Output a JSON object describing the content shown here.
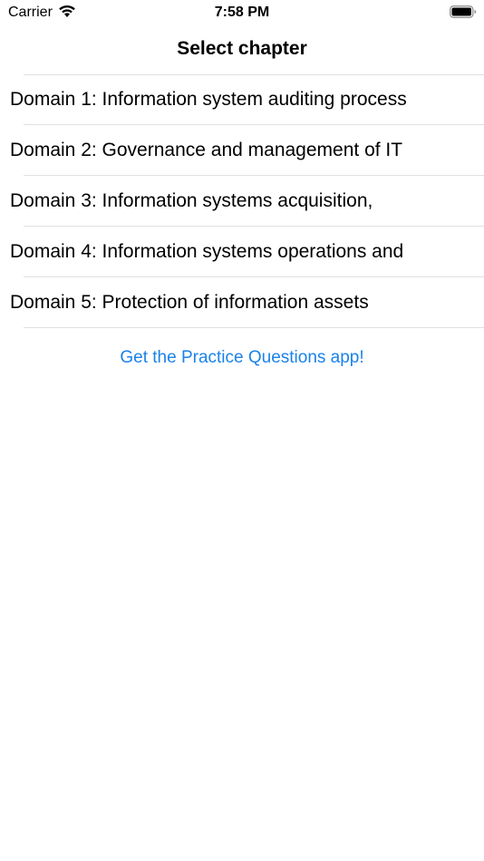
{
  "status_bar": {
    "carrier": "Carrier",
    "time": "7:58 PM",
    "icons": [
      "wifi-icon",
      "battery-icon"
    ]
  },
  "nav": {
    "title": "Select chapter"
  },
  "chapters": [
    {
      "label": "Domain 1: Information system auditing process"
    },
    {
      "label": "Domain 2: Governance and management of IT"
    },
    {
      "label": "Domain 3: Information systems acquisition,"
    },
    {
      "label": "Domain 4: Information systems operations and"
    },
    {
      "label": "Domain 5: Protection of information assets"
    }
  ],
  "promo": {
    "link_text": "Get the Practice Questions app!"
  },
  "colors": {
    "link": "#1a82e8",
    "separator": "#e0e0e4",
    "background": "#ffffff",
    "text": "#000000"
  }
}
